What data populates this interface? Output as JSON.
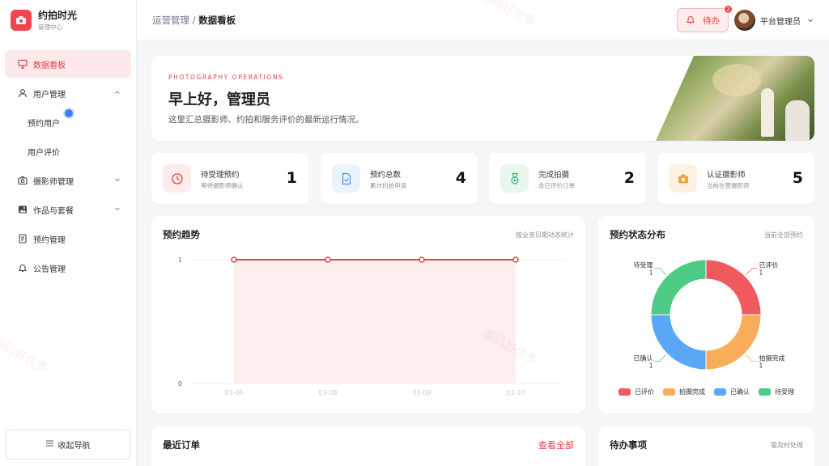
{
  "app": {
    "title": "约拍时光",
    "subtitle": "管理中心"
  },
  "sidebar": {
    "items": [
      {
        "label": "数据看板"
      },
      {
        "label": "用户管理"
      },
      {
        "label": "预约用户"
      },
      {
        "label": "用户评价"
      },
      {
        "label": "摄影师管理"
      },
      {
        "label": "作品与套餐"
      },
      {
        "label": "预约管理"
      },
      {
        "label": "公告管理"
      }
    ],
    "collapse_label": "收起导航"
  },
  "header": {
    "breadcrumb_parent": "运营管理 /",
    "breadcrumb_current": "数据看板",
    "todo_label": "待办",
    "todo_badge": "2",
    "user_name": "平台管理员"
  },
  "hero": {
    "kicker": "PHOTOGRAPHY OPERATIONS",
    "title": "早上好，管理员",
    "description": "这里汇总摄影师、约拍和服务评价的最新运行情况。"
  },
  "stats": [
    {
      "title": "待受理预约",
      "sub": "等待摄影师确认",
      "value": "1",
      "icon": "clock-icon",
      "color": "#e5404a"
    },
    {
      "title": "预约总数",
      "sub": "累计约拍申请",
      "value": "4",
      "icon": "file-check-icon",
      "color": "#4a90e2"
    },
    {
      "title": "完成拍摄",
      "sub": "含已评价订单",
      "value": "2",
      "icon": "medal-icon",
      "color": "#3bb273"
    },
    {
      "title": "认证摄影师",
      "sub": "当前在营摄影师",
      "value": "5",
      "icon": "camera-icon",
      "color": "#f0a33c"
    }
  ],
  "trend": {
    "title": "预约趋势",
    "note": "按业务日期动态统计"
  },
  "status": {
    "title": "预约状态分布",
    "note": "当前全部预约"
  },
  "recent": {
    "title": "最近订单",
    "link": "查看全部"
  },
  "todos": {
    "title": "待办事项",
    "note": "需及时处理"
  },
  "watermark": "源码好优多",
  "colors": {
    "accent": "#e5404a"
  },
  "chart_data": [
    {
      "type": "area",
      "x": [
        "03-06",
        "03-08",
        "03-09",
        "03-10"
      ],
      "series": [
        {
          "values": [
            1,
            1,
            1,
            1
          ]
        }
      ],
      "yticks": [
        "0",
        "1"
      ],
      "ylim": [
        0,
        1
      ],
      "color": "#e5404a",
      "grid": true
    },
    {
      "type": "pie",
      "donut": true,
      "labels": [
        "已评价",
        "拍摄完成",
        "已确认",
        "待受理"
      ],
      "values": [
        1,
        1,
        1,
        1
      ],
      "colors": [
        "#f05a5f",
        "#f9ad5a",
        "#5aa6f7",
        "#4ecb84"
      ],
      "legend": "bottom"
    }
  ]
}
